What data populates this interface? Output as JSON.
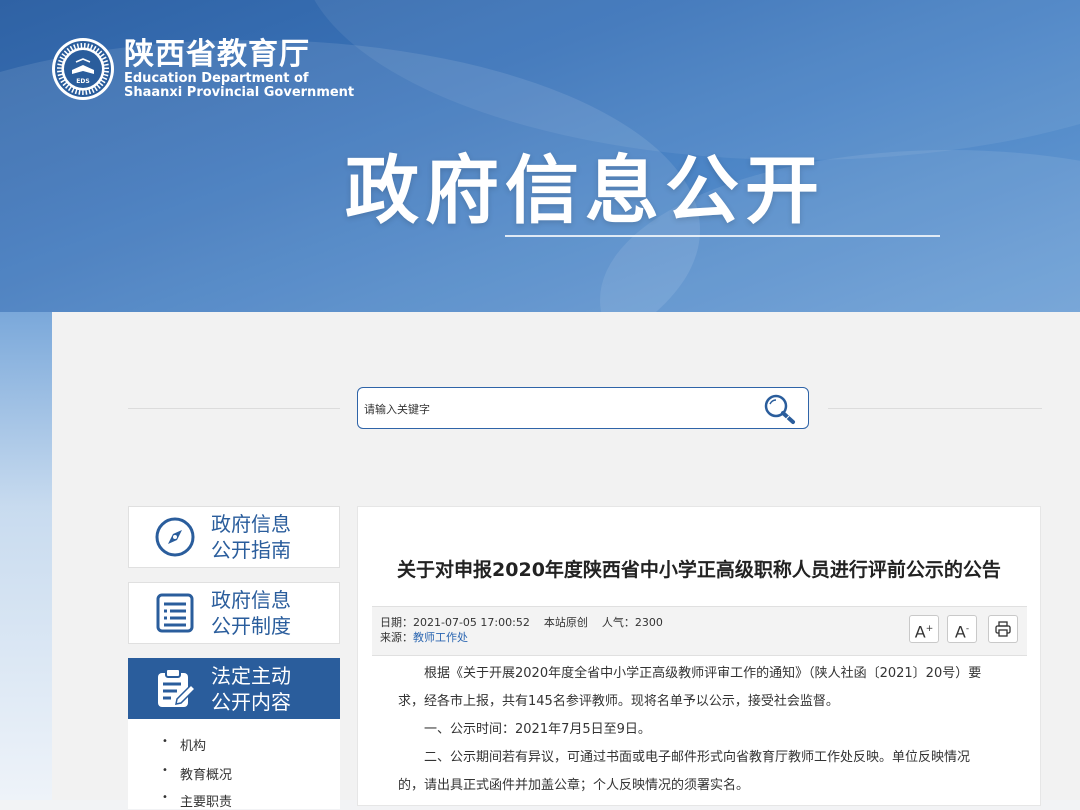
{
  "header": {
    "org_cn": "陕西省教育厅",
    "org_en_line1": "Education Department of",
    "org_en_line2": "Shaanxi Provincial Government",
    "emblem_text": "EDS",
    "page_title": "政府信息公开"
  },
  "search": {
    "placeholder": "请输入关键字",
    "icon": "search-icon"
  },
  "sidebar": {
    "items": [
      {
        "line1": "政府信息",
        "line2": "公开指南",
        "icon": "compass-icon",
        "active": false
      },
      {
        "line1": "政府信息",
        "line2": "公开制度",
        "icon": "document-list-icon",
        "active": false
      },
      {
        "line1": "法定主动",
        "line2": "公开内容",
        "icon": "clipboard-edit-icon",
        "active": true
      }
    ],
    "sub_items": [
      "机构",
      "教育概况",
      "主要职责"
    ]
  },
  "article": {
    "title": "关于对申报2020年度陕西省中小学正高级职称人员进行评前公示的公告",
    "meta": {
      "date_label": "日期：",
      "date": "2021-07-05 17:00:52",
      "origin": "本站原创",
      "views_label": "人气：",
      "views": "2300",
      "source_label": "来源：",
      "source": "教师工作处"
    },
    "tools": {
      "font_up": "A",
      "font_down": "A",
      "print_icon": "print-icon"
    },
    "paragraphs": [
      "根据《关于开展2020年度全省中小学正高级教师评审工作的通知》（陕人社函〔2021〕20号）要",
      "求，经各市上报，共有145名参评教师。现将名单予以公示，接受社会监督。",
      "一、公示时间：2021年7月5日至9日。",
      "二、公示期间若有异议，可通过书面或电子邮件形式向省教育厅教师工作处反映。单位反映情况",
      "的，请出具正式函件并加盖公章；个人反映情况的须署实名。"
    ]
  },
  "colors": {
    "brand_blue": "#2a5d9c",
    "link_blue": "#2b66b1"
  }
}
